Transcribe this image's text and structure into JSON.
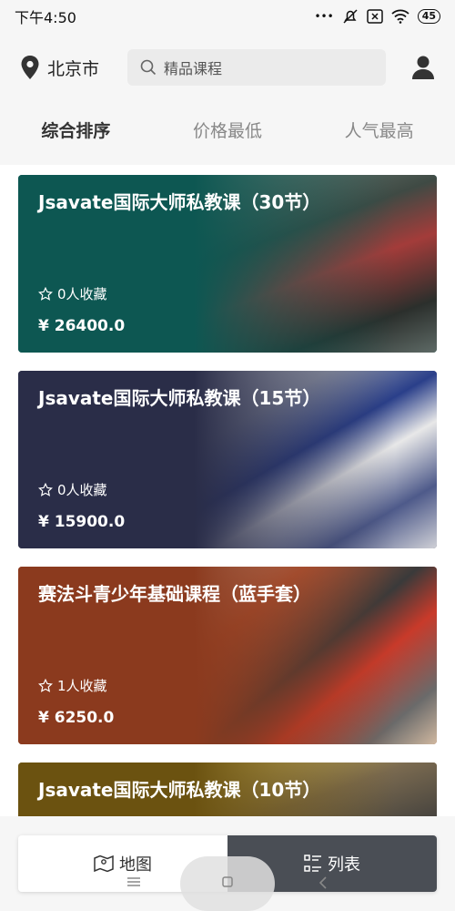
{
  "status_bar": {
    "time": "下午4:50",
    "dots": "•••",
    "battery": "45"
  },
  "header": {
    "city": "北京市",
    "search_placeholder": "精品课程"
  },
  "sort_tabs": [
    {
      "label": "综合排序",
      "active": true
    },
    {
      "label": "价格最低",
      "active": false
    },
    {
      "label": "人气最高",
      "active": false
    }
  ],
  "courses": [
    {
      "title": "Jsavate国际大师私教课（30节）",
      "favorites": "0人收藏",
      "price": "¥ 26400.0",
      "color": "#0d5752"
    },
    {
      "title": "Jsavate国际大师私教课（15节）",
      "favorites": "0人收藏",
      "price": "¥ 15900.0",
      "color": "#2a2d48"
    },
    {
      "title": "赛法斗青少年基础课程（蓝手套）",
      "favorites": "1人收藏",
      "price": "¥ 6250.0",
      "color": "#8b3a1e"
    },
    {
      "title": "Jsavate国际大师私教课（10节）",
      "favorites": "",
      "price": "",
      "color": "#6b5210"
    }
  ],
  "view_toggle": {
    "map_label": "地图",
    "list_label": "列表"
  },
  "icons": [
    "location-pin-icon",
    "search-icon",
    "user-icon",
    "star-icon",
    "map-icon",
    "list-icon"
  ]
}
